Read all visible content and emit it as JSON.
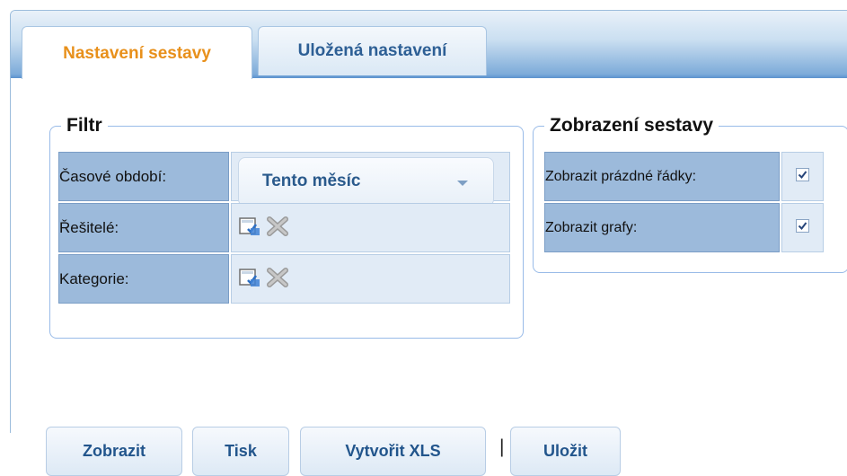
{
  "tabs": [
    {
      "label": "Nastavení sestavy",
      "active": true
    },
    {
      "label": "Uložená nastavení",
      "active": false
    }
  ],
  "filter": {
    "legend": "Filtr",
    "rows": [
      {
        "label": "Časové období:",
        "type": "select",
        "value": "Tento měsíc"
      },
      {
        "label": "Řešitelé:",
        "type": "picker"
      },
      {
        "label": "Kategorie:",
        "type": "picker"
      }
    ]
  },
  "display": {
    "legend": "Zobrazení sestavy",
    "rows": [
      {
        "label": "Zobrazit prázdné řádky:",
        "checked": true
      },
      {
        "label": "Zobrazit grafy:",
        "checked": true
      }
    ]
  },
  "buttons": {
    "show": "Zobrazit",
    "print": "Tisk",
    "xls": "Vytvořit XLS",
    "separator": "|",
    "save": "Uložit"
  },
  "icons": {
    "select": "edit-select-icon",
    "clear": "clear-x-icon",
    "check": "checkmark-icon"
  },
  "colors": {
    "active_tab_text": "#e8901b",
    "tab_text": "#2d5f95",
    "label_bg": "#9cbadb",
    "value_bg": "#e1ebf6"
  }
}
